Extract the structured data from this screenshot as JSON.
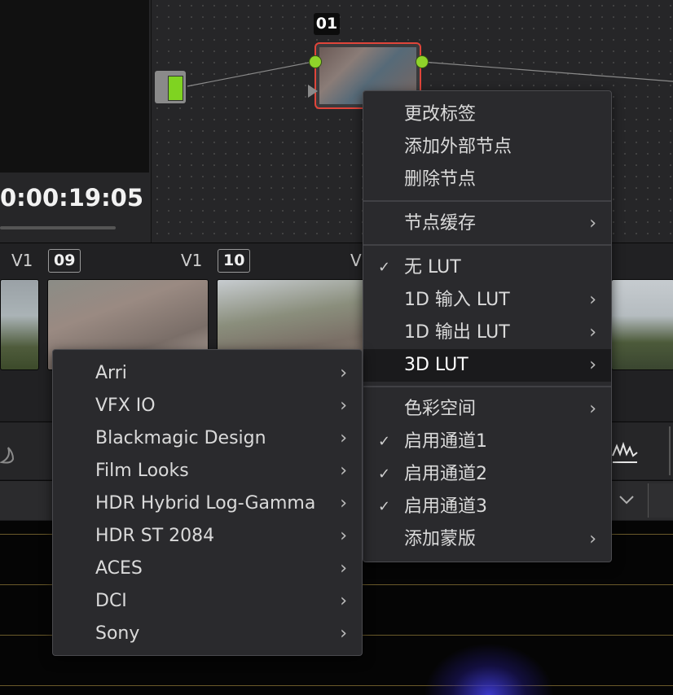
{
  "viewer": {
    "timecode": "0:00:19:05"
  },
  "node_graph": {
    "node_label": "01"
  },
  "timeline": {
    "track_labels": [
      "V1",
      "V1",
      "V"
    ],
    "clip_numbers": [
      "09",
      "10"
    ]
  },
  "context_menu": {
    "items": [
      {
        "label": "更改标签"
      },
      {
        "label": "添加外部节点"
      },
      {
        "label": "删除节点"
      },
      {
        "label": "节点缓存"
      },
      {
        "label": "无 LUT"
      },
      {
        "label": "1D 输入 LUT"
      },
      {
        "label": "1D 输出 LUT"
      },
      {
        "label": "3D LUT"
      },
      {
        "label": "色彩空间"
      },
      {
        "label": "启用通道1"
      },
      {
        "label": "启用通道2"
      },
      {
        "label": "启用通道3"
      },
      {
        "label": "添加蒙版"
      }
    ],
    "checkmark": "✓",
    "arrow": "›"
  },
  "lut_submenu": {
    "items": [
      {
        "label": "Arri"
      },
      {
        "label": "VFX IO"
      },
      {
        "label": "Blackmagic Design"
      },
      {
        "label": "Film Looks"
      },
      {
        "label": "HDR Hybrid Log-Gamma"
      },
      {
        "label": "HDR ST 2084"
      },
      {
        "label": "ACES"
      },
      {
        "label": "DCI"
      },
      {
        "label": "Sony"
      }
    ]
  },
  "colors": {
    "accent_green": "#7fd321",
    "node_border": "#e0453a",
    "menu_bg": "#2a2a2d"
  }
}
